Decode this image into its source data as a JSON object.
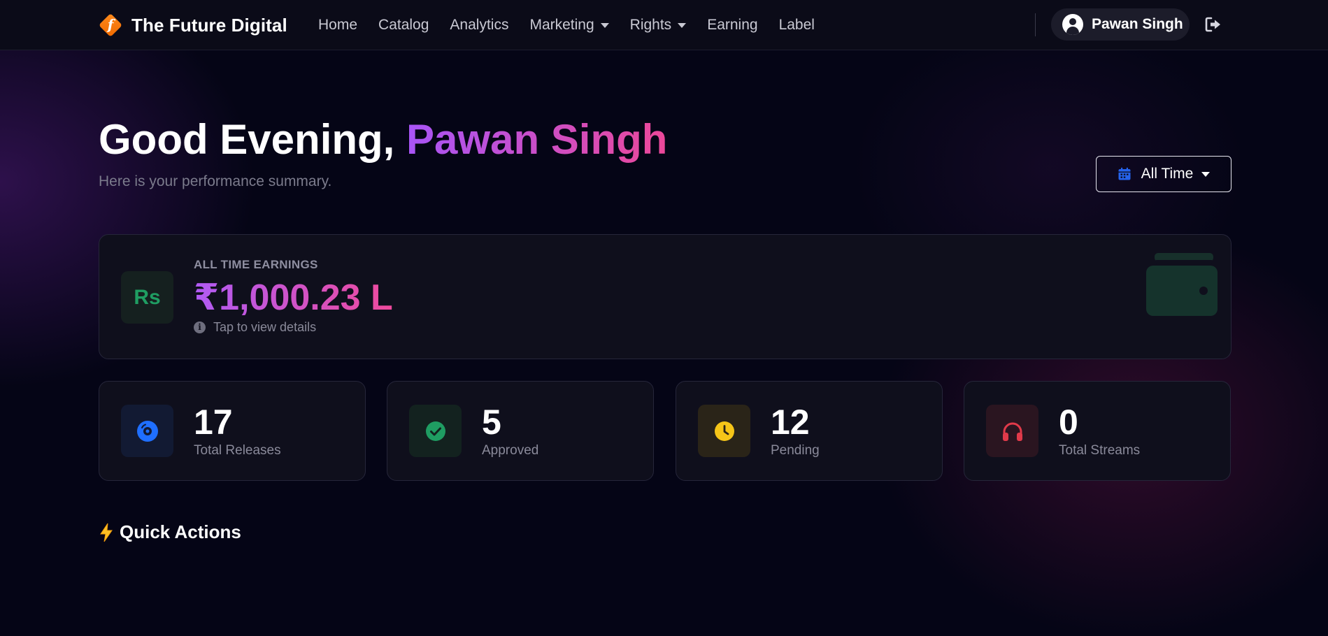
{
  "navbar": {
    "brand_name": "The Future Digital",
    "brand_glyph": "f",
    "links": [
      {
        "label": "Home",
        "dropdown": false
      },
      {
        "label": "Catalog",
        "dropdown": false
      },
      {
        "label": "Analytics",
        "dropdown": false
      },
      {
        "label": "Marketing",
        "dropdown": true
      },
      {
        "label": "Rights",
        "dropdown": true
      },
      {
        "label": "Earning",
        "dropdown": false
      },
      {
        "label": "Label",
        "dropdown": false
      }
    ],
    "user_name": "Pawan Singh",
    "user_icon": "user-circle-icon",
    "logout_icon": "logout-icon"
  },
  "header": {
    "greeting_prefix": "Good Evening, ",
    "greeting_name": "Pawan Singh",
    "subtitle": "Here is your performance summary.",
    "period_label": "All Time",
    "period_icon": "calendar-icon"
  },
  "earnings": {
    "icon_text": "Rs",
    "label": "ALL TIME EARNINGS",
    "value": "₹1,000.23 L",
    "hint": "Tap to view details",
    "hint_icon": "info-icon",
    "deco_icon": "wallet-icon"
  },
  "stats": [
    {
      "value": "17",
      "label": "Total Releases",
      "icon": "disc-icon",
      "color": "#1f6fff",
      "bg": "#121a33"
    },
    {
      "value": "5",
      "label": "Approved",
      "icon": "check-circle-icon",
      "color": "#1f9d62",
      "bg": "#13221f"
    },
    {
      "value": "12",
      "label": "Pending",
      "icon": "clock-icon",
      "color": "#f5c518",
      "bg": "#2a2418"
    },
    {
      "value": "0",
      "label": "Total Streams",
      "icon": "headphones-icon",
      "color": "#e03a4a",
      "bg": "#2a1520"
    }
  ],
  "quick_actions": {
    "title": "Quick Actions",
    "icon": "lightning-icon"
  },
  "colors": {
    "accent_purple": "#a855f7",
    "accent_pink": "#ec4899",
    "background": "#050516",
    "card": "#0f0f1c"
  }
}
